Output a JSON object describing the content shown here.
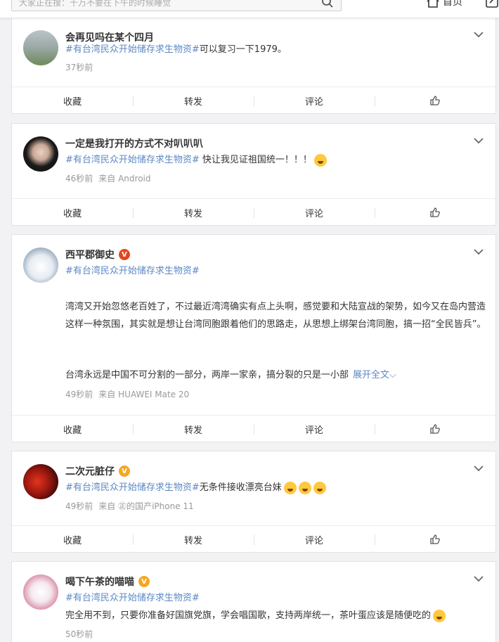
{
  "header": {
    "search_placeholder": "大家正在搜：千万不要在下午的时候睡觉",
    "home_label": "首页"
  },
  "actions": {
    "collect": "收藏",
    "repost": "转发",
    "comment": "评论"
  },
  "posts": [
    {
      "name": "会再见吗在某个四月",
      "topic": "#有台湾民众开始储存求生物资#",
      "text": "可以复习一下1979。",
      "time": "37秒前",
      "source": ""
    },
    {
      "name": "一定是我打开的方式不对叭叭叭",
      "topic": "#有台湾民众开始储存求生物资#",
      "text": " 快让我见证祖国统一！！！",
      "time": "46秒前",
      "source": "来自 Android"
    },
    {
      "name": "西平郡御史",
      "topic": "#有台湾民众开始储存求生物资#",
      "para1": "湾湾又开始忽悠老百姓了，不过最近湾湾确实有点上头啊，感觉要和大陆宣战的架势，如今又在岛内营造这样一种氛围，其实就是想让台湾同胞跟着他们的思路走，从思想上绑架台湾同胞，搞一招“全民皆兵”。",
      "para2": "台湾永远是中国不可分割的一部分，两岸一家亲，搞分裂的只是一小部",
      "more": "展开全文",
      "time": "49秒前",
      "source": "来自 HUAWEI Mate 20"
    },
    {
      "name": "二次元脏仔",
      "topic": "#有台湾民众开始储存求生物资#",
      "text": "无条件接收漂亮台妹",
      "time": "49秒前",
      "source": "来自 ㊣的国产iPhone 11"
    },
    {
      "name": "喝下午茶的喵喵",
      "topic": "#有台湾民众开始储存求生物资#",
      "text": "完全用不到，只要你准备好国旗党旗，学会唱国歌，支持两岸统一，茶叶蛋应该是随便吃的",
      "time": "50秒前",
      "source": ""
    }
  ],
  "colors": {
    "link": "#5b88c4",
    "gold_badge": "#f5a623",
    "red_badge": "#e5461e"
  }
}
